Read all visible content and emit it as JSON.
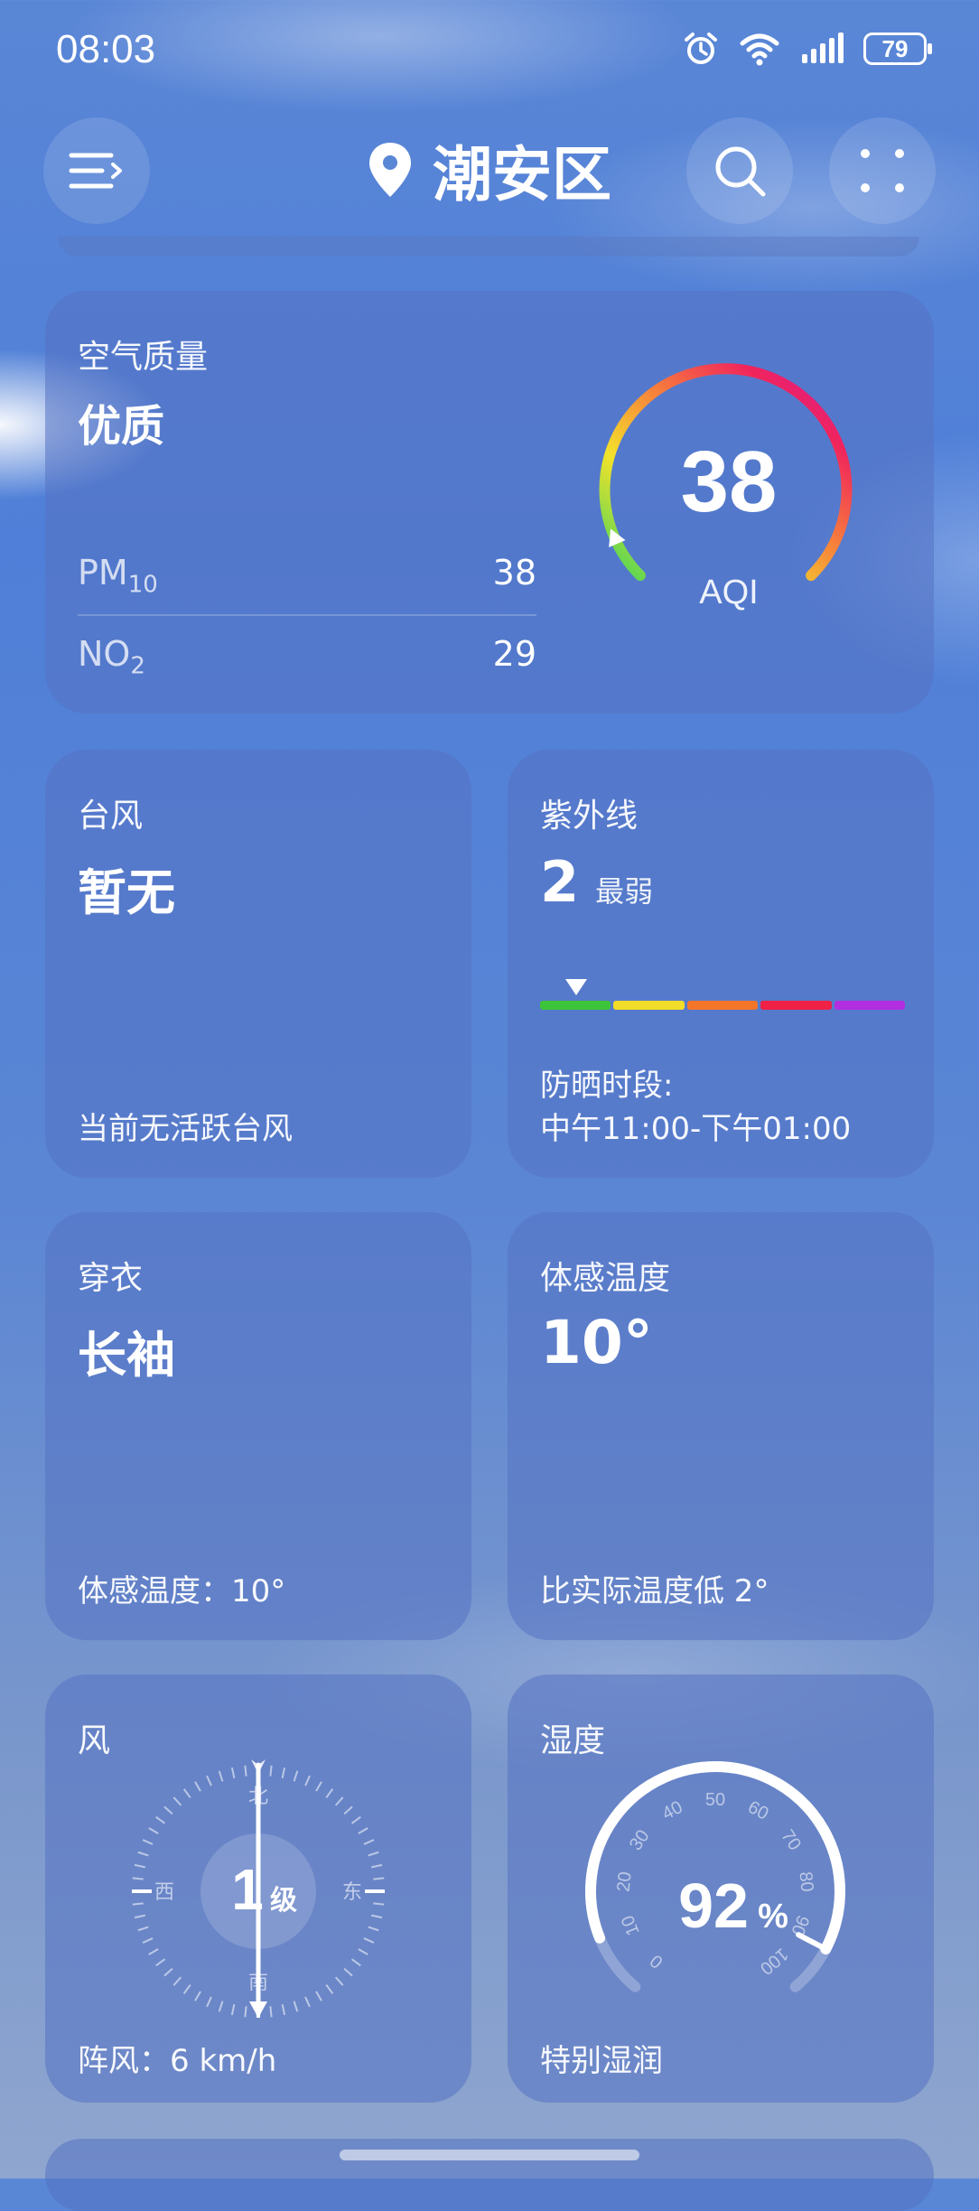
{
  "status_bar": {
    "time": "08:03",
    "battery": "79",
    "icons": [
      "alarm-icon",
      "wifi-icon",
      "signal-icon",
      "battery-icon"
    ]
  },
  "header": {
    "city": "潮安区",
    "icons": [
      "menu-icon",
      "location-pin-icon",
      "search-icon",
      "more-icon"
    ]
  },
  "air_quality": {
    "title": "空气质量",
    "level": "优质",
    "aqi_value": "38",
    "aqi_label": "AQI",
    "aqi_fraction": 0.08,
    "rows": [
      {
        "label": "PM",
        "sub": "10",
        "value": "38"
      },
      {
        "label": "NO",
        "sub": "2",
        "value": "29"
      }
    ]
  },
  "typhoon": {
    "title": "台风",
    "value": "暂无",
    "footer": "当前无活跃台风"
  },
  "uv": {
    "title": "紫外线",
    "value": "2",
    "level": "最弱",
    "position_fraction": 0.1,
    "scale_colors": [
      "#3ec43a",
      "#f2dd2a",
      "#f2752a",
      "#ef2146",
      "#b22ee0"
    ],
    "footer_label": "防晒时段:",
    "footer_value": "中午11:00-下午01:00"
  },
  "clothing": {
    "title": "穿衣",
    "value": "长袖",
    "footer": "体感温度：10°"
  },
  "feels_like": {
    "title": "体感温度",
    "value": "10°",
    "footer": "比实际温度低 2°"
  },
  "wind": {
    "title": "风",
    "level_number": "1",
    "level_unit": "级",
    "directions": {
      "north": "北",
      "south": "南",
      "west": "西",
      "east": "东"
    },
    "footer": "阵风：6 km/h"
  },
  "humidity": {
    "title": "湿度",
    "value": "92",
    "unit": "%",
    "percent": 92,
    "ticks": [
      "0",
      "10",
      "20",
      "30",
      "40",
      "50",
      "60",
      "70",
      "80",
      "90",
      "100"
    ],
    "footer": "特别湿润"
  }
}
